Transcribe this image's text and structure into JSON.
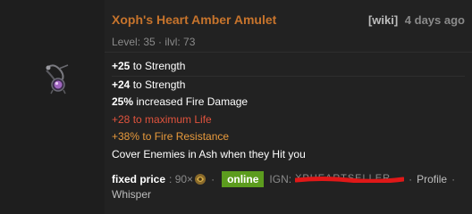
{
  "item": {
    "name": "Xoph's Heart Amber Amulet",
    "wiki_label": "[wiki]",
    "posted": "4 days ago",
    "level_line": "Level: 35 · ilvl: 73",
    "icon": "amber-amulet-icon"
  },
  "mods": [
    {
      "value": "+25",
      "text": " to Strength"
    },
    {
      "value": "+24",
      "text": " to Strength"
    },
    {
      "value": "25%",
      "text": " increased Fire Damage"
    },
    {
      "full": "+28 to maximum Life"
    },
    {
      "full": "+38% to Fire Resistance"
    },
    {
      "full": "Cover Enemies in Ash when they Hit you"
    }
  ],
  "listing": {
    "price_label": "fixed price",
    "price_value": ": 90×",
    "currency_icon": "chaos-orb-icon",
    "online_label": "online",
    "ign_label": "IGN:",
    "ign_value": "XPHEARTSELLER",
    "profile_label": "Profile",
    "whisper_label": "Whisper"
  },
  "colors": {
    "item_name": "#c7742c",
    "online_badge": "#5c9c1e",
    "life_mod": "#e0533d",
    "resist_mod": "#e89a3c",
    "redaction": "#e01818"
  }
}
